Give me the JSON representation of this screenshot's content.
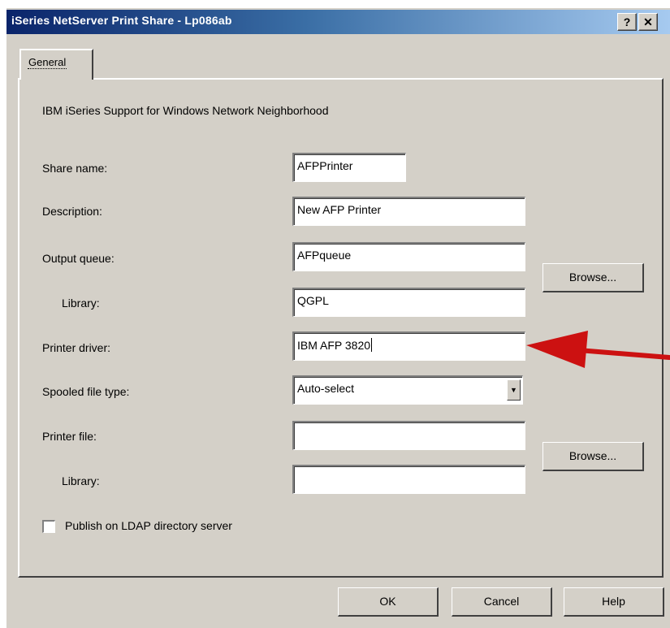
{
  "window": {
    "title": "iSeries NetServer Print Share - Lp086ab",
    "help_label": "?",
    "close_label": "✕"
  },
  "tabs": [
    {
      "label": "General",
      "selected": true
    }
  ],
  "header_text": "IBM iSeries Support for Windows Network Neighborhood",
  "form": {
    "share_name": {
      "label": "Share name:",
      "value": "AFPPrinter"
    },
    "description": {
      "label": "Description:",
      "value": "New AFP Printer"
    },
    "output_queue": {
      "label": "Output queue:",
      "value": "AFPqueue"
    },
    "oq_library": {
      "label": "Library:",
      "value": "QGPL"
    },
    "printer_driver": {
      "label": "Printer driver:",
      "value": "IBM AFP 3820"
    },
    "spooled_type": {
      "label": "Spooled file type:",
      "value": "Auto-select"
    },
    "printer_file": {
      "label": "Printer file:",
      "value": ""
    },
    "pf_library": {
      "label": "Library:",
      "value": ""
    },
    "browse_label": "Browse...",
    "ldap": {
      "label": "Publish on LDAP directory server",
      "checked": false
    }
  },
  "buttons": {
    "ok": "OK",
    "cancel": "Cancel",
    "help": "Help"
  },
  "colors": {
    "annotation_arrow": "#cc1111",
    "title_bar": "#0a246a",
    "dialog_bg": "#d4d0c8"
  },
  "icons": {
    "dropdown": "chevron-down-icon",
    "annotation": "red-arrow-icon"
  }
}
